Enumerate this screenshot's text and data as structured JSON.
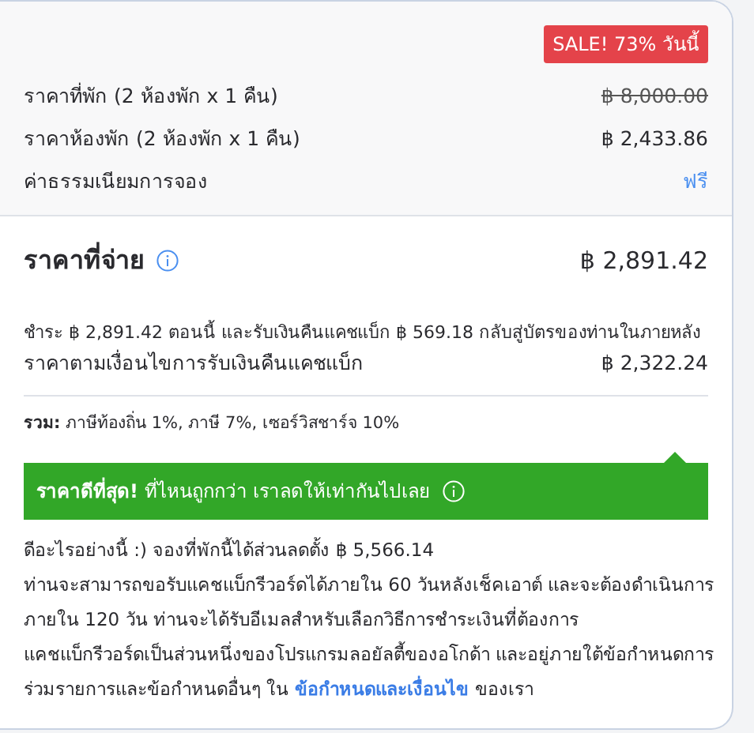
{
  "badge": "SALE! 73% วันนี้",
  "price_rows": [
    {
      "label": "ราคาที่พัก (2 ห้องพัก x 1 คืน)",
      "value": "฿ 8,000.00",
      "kind": "struck"
    },
    {
      "label": "ราคาห้องพัก (2 ห้องพัก x 1 คืน)",
      "value": "฿ 2,433.86",
      "kind": "plain"
    },
    {
      "label": "ค่าธรรมเนียมการจอง",
      "value": "ฟรี",
      "kind": "link"
    }
  ],
  "total": {
    "label": "ราคาที่จ่าย",
    "value": "฿ 2,891.42"
  },
  "cashback_note": "ชำระ ฿ 2,891.42 ตอนนี้ และรับเงินคืนแคชแบ็ก ฿ 569.18 กลับสู่บัตรของท่านในภายหลัง",
  "cashback_row": {
    "label": "ราคาตามเงื่อนไขการรับเงินคืนแคชแบ็ก",
    "value": "฿ 2,322.24"
  },
  "taxes": "**รวม:** ภาษีท้องถิ่น 1%, ภาษี 7%, เซอร์วิสชาร์จ 10%",
  "banner": "**ราคาดีที่สุด!** ที่ไหนถูกกว่า เราลดให้เท่ากันไปเลย",
  "savings": "ดีอะไรอย่างนี้ :) จองที่พักนี้ได้ส่วนลดตั้ง ฿ 5,566.14",
  "terms_lines": [
    "ท่านจะสามารถขอรับแคชแบ็กรีวอร์ดได้ภายใน 60 วันหลังเช็คเอาต์ และจะต้องดำเนินการ",
    "ภายใน 120 วัน ท่านจะได้รับอีเมลสำหรับเลือกวิธีการชำระเงินที่ต้องการ",
    "แคชแบ็กรีวอร์ดเป็นส่วนหนึ่งของโปรแกรมลอยัลตี้ของอโกด้า และอยู่ภายใต้ข้อกำหนดการ"
  ],
  "terms_last": {
    "before": "ร่วมรายการและข้อกำหนดอื่นๆ ใน",
    "link": "ข้อกำหนดและเงื่อนไข",
    "after": "ของเรา"
  }
}
